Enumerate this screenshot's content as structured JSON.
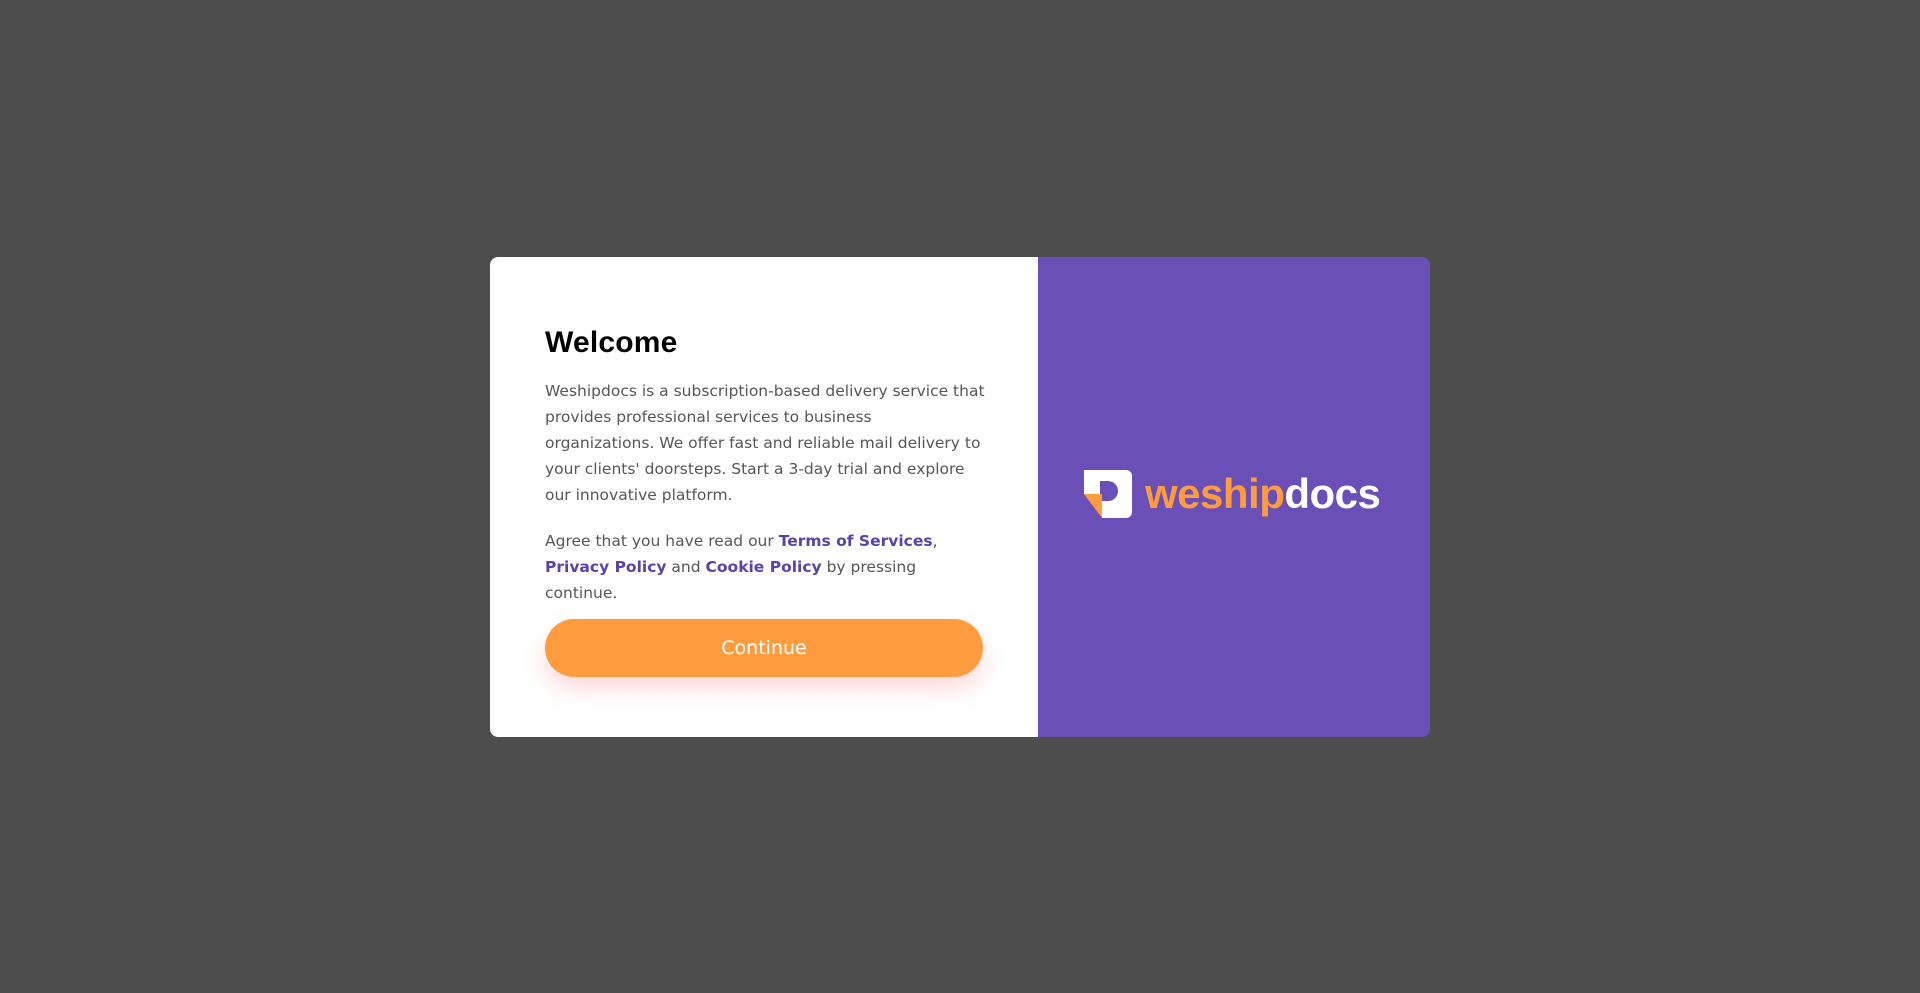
{
  "dialog": {
    "title": "Welcome",
    "description": "Weshipdocs is a subscription-based delivery service that provides professional services to business organizations. We offer fast and reliable mail delivery to your clients' doorsteps. Start a 3-day trial and explore our innovative platform.",
    "agreement": {
      "prefix": "Agree that you have read our ",
      "terms_link": "Terms of Services",
      "sep_comma": ", ",
      "privacy_link": "Privacy Policy",
      "sep_and": " and ",
      "cookie_link": "Cookie Policy",
      "suffix": " by pressing continue."
    },
    "continue_label": "Continue"
  },
  "brand": {
    "logo_icon": "weshipdocs-logo-icon",
    "word_part_1": "weship",
    "word_part_2": "docs"
  },
  "colors": {
    "backdrop": "#4d4d4d",
    "panel": "#ffffff",
    "brand_purple": "#694fb6",
    "accent_orange": "#ff9c40",
    "link": "#5a43a8",
    "body_text": "#565656"
  }
}
